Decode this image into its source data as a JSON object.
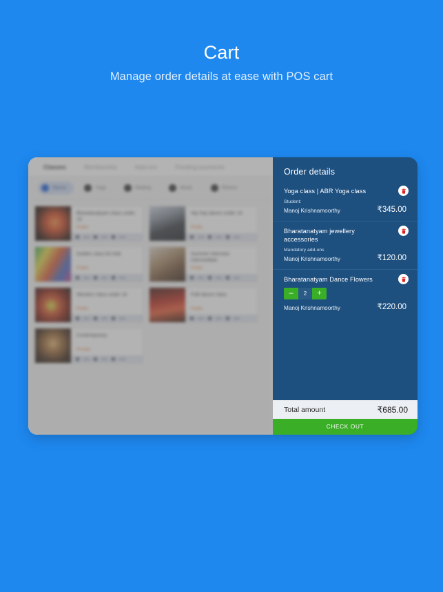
{
  "hero": {
    "title": "Cart",
    "subtitle": "Manage order details at ease with POS cart"
  },
  "colors": {
    "background": "#1e88ef",
    "panel": "#1d4f7f",
    "accent_green": "#3bae28",
    "total_bar": "#eceff3",
    "trash_red": "#e02020"
  },
  "left_pane": {
    "tabs": [
      {
        "label": "Classes",
        "active": true
      },
      {
        "label": "Membership",
        "active": false
      },
      {
        "label": "Add-ons",
        "active": false
      },
      {
        "label": "Pending payments",
        "active": false
      }
    ],
    "filter_chips": [
      {
        "label": "Dance",
        "selected": true
      },
      {
        "label": "Yoga",
        "selected": false
      },
      {
        "label": "Skating",
        "selected": false
      },
      {
        "label": "Music",
        "selected": false
      },
      {
        "label": "Fitness",
        "selected": false
      }
    ],
    "cards": [
      {
        "title": "Bharatanatyam class under 16",
        "price": "Public",
        "thumb": "t1"
      },
      {
        "title": "Hip hop dance under 16",
        "price": "Public",
        "thumb": "t2"
      },
      {
        "title": "Golden class for kids",
        "price": "Public",
        "thumb": "t3"
      },
      {
        "title": "Summer intensive intermediate",
        "price": "Public",
        "thumb": "t4"
      },
      {
        "title": "Western class under 16",
        "price": "Public",
        "thumb": "t5"
      },
      {
        "title": "Folk dance class",
        "price": "Public",
        "thumb": "t6"
      },
      {
        "title": "Contemporary",
        "price": "Private",
        "thumb": "t7"
      }
    ]
  },
  "order": {
    "title": "Order details",
    "items": [
      {
        "name": "Yoga class | ABR Yoga class",
        "sub": "Student:",
        "student": "Manoj Krishnamoorthy",
        "price": "₹345.00",
        "has_stepper": false,
        "quantity": null,
        "delete_icon": "trash-icon"
      },
      {
        "name": "Bharatanatyam jewellery accessories",
        "sub": "Mandatory add-ons",
        "student": "Manoj Krishnamoorthy",
        "price": "₹120.00",
        "has_stepper": false,
        "quantity": null,
        "delete_icon": "trash-icon"
      },
      {
        "name": "Bharatanatyam Dance Flowers",
        "sub": "",
        "student": "Manoj Krishnamoorthy",
        "price": "₹220.00",
        "has_stepper": true,
        "quantity": "2",
        "decrement_label": "–",
        "increment_label": "+",
        "delete_icon": "trash-icon"
      }
    ],
    "total_label": "Total amount",
    "total_value": "₹685.00",
    "checkout_label": "CHECK OUT"
  }
}
